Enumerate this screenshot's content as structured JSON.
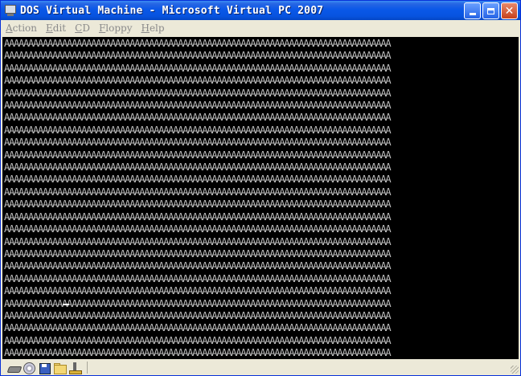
{
  "window": {
    "title": "DOS Virtual Machine - Microsoft Virtual PC 2007"
  },
  "menu": [
    {
      "accel": "A",
      "rest": "ction"
    },
    {
      "accel": "E",
      "rest": "dit"
    },
    {
      "accel": "C",
      "rest": "D"
    },
    {
      "accel": "F",
      "rest": "loppy"
    },
    {
      "accel": "H",
      "rest": "elp"
    }
  ],
  "screen": {
    "fill_char": "A",
    "rows": 26,
    "columns": 80,
    "text_color": "#C0C0C0",
    "background": "#000000"
  },
  "statusbar": {
    "icons": [
      "hard-disk-icon",
      "cd-drive-icon",
      "floppy-drive-icon",
      "shared-folder-icon",
      "network-icon"
    ]
  }
}
